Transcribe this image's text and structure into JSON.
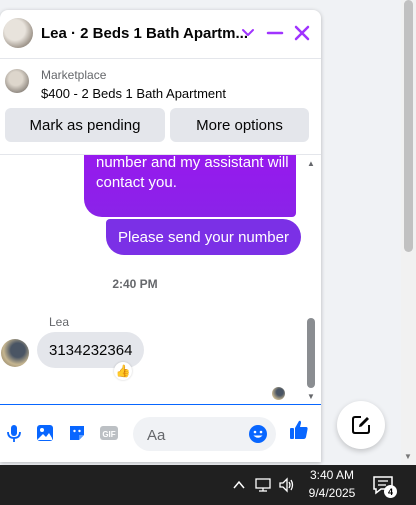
{
  "header": {
    "title": "Lea · 2 Beds 1 Bath Apartm...",
    "accent": "#a033ff"
  },
  "marketplace": {
    "label": "Marketplace",
    "listing": "$400 - 2 Beds 1 Bath Apartment",
    "pending_button": "Mark as pending",
    "more_button": "More options"
  },
  "messages": {
    "outgoing_partial": "more, please leave your number and my assistant will contact you.",
    "outgoing_2": "Please send your number",
    "timestamp": "2:40 PM",
    "sender_name": "Lea",
    "incoming_1": "3134232364",
    "reaction": "👍"
  },
  "composer": {
    "placeholder": "Aa",
    "icons": [
      "microphone-icon",
      "photo-icon",
      "sticker-icon",
      "gif-icon",
      "emoji-icon",
      "thumbs-up-icon"
    ]
  },
  "taskbar": {
    "time": "3:40 AM",
    "date": "9/4/2025",
    "notification_count": "4"
  }
}
